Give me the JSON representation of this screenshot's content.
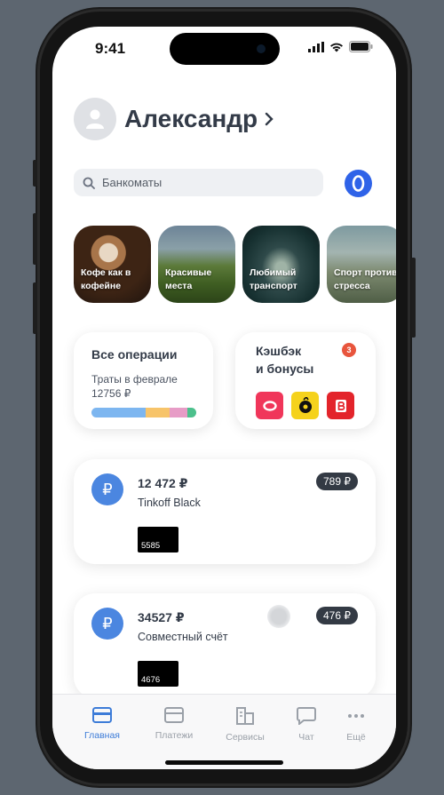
{
  "status_bar": {
    "time": "9:41"
  },
  "profile": {
    "name": "Александр"
  },
  "search": {
    "placeholder": "Банкоматы"
  },
  "stories": [
    {
      "label": "Кофе как в кофейне"
    },
    {
      "label": "Красивые места"
    },
    {
      "label": "Любимый транспорт"
    },
    {
      "label": "Спорт против стресса"
    }
  ],
  "operations_widget": {
    "title": "Все операции",
    "subtitle_line1": "Траты в феврале",
    "subtitle_line2": "12756 ₽",
    "segment_colors": [
      "#7db6f0",
      "#f7c46a",
      "#e79cc6",
      "#4cc08c"
    ]
  },
  "cashback_widget": {
    "title_line1": "Кэшбэк",
    "title_line2": "и бонусы",
    "badge_count": "3",
    "partner_icons": [
      "ozon-style-icon",
      "yellow-partner-icon",
      "red-partner-icon"
    ]
  },
  "accounts": [
    {
      "balance": "12 472 ₽",
      "name": "Tinkoff Black",
      "pill": "789 ₽",
      "card_last4": "5585"
    },
    {
      "balance": "34527 ₽",
      "name": "Совместный счёт",
      "pill": "476 ₽",
      "card_last4": "4676"
    }
  ],
  "tabbar": {
    "items": [
      {
        "label": "Главная",
        "icon": "card-icon",
        "active": true
      },
      {
        "label": "Платежи",
        "icon": "payment-card-icon",
        "active": false
      },
      {
        "label": "Сервисы",
        "icon": "buildings-icon",
        "active": false
      },
      {
        "label": "Чат",
        "icon": "chat-icon",
        "active": false
      },
      {
        "label": "Ещё",
        "icon": "more-dots-icon",
        "active": false
      }
    ]
  },
  "colors": {
    "accent": "#3d7cd8",
    "account_icon": "#4b86e0",
    "text": "#333b48"
  }
}
